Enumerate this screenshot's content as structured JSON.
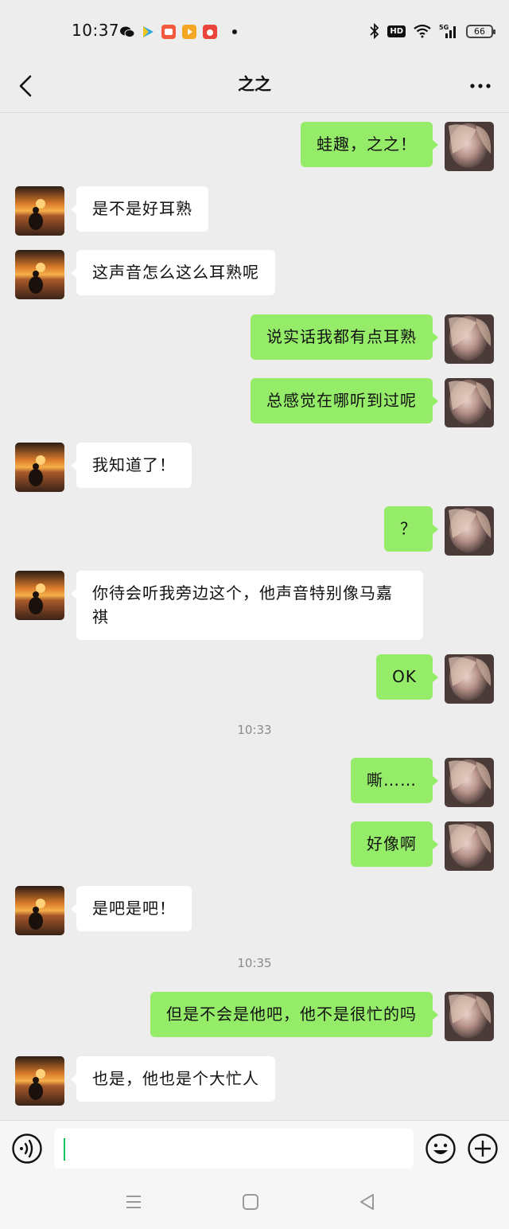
{
  "status_bar": {
    "time": "10:37",
    "network": "5G",
    "battery": "66"
  },
  "header": {
    "title": "之之"
  },
  "colors": {
    "outgoing_bubble": "#95ec69",
    "incoming_bubble": "#ffffff",
    "background": "#ededed",
    "caret": "#07c160"
  },
  "messages": [
    {
      "side": "out",
      "text": "蛙趣，之之！"
    },
    {
      "side": "in",
      "text": "是不是好耳熟"
    },
    {
      "side": "in",
      "text": "这声音怎么这么耳熟呢"
    },
    {
      "side": "out",
      "text": "说实话我都有点耳熟"
    },
    {
      "side": "out",
      "text": "总感觉在哪听到过呢"
    },
    {
      "side": "in",
      "text": "我知道了！"
    },
    {
      "side": "out",
      "text": "？"
    },
    {
      "side": "in",
      "text": "你待会听我旁边这个，他声音特别像马嘉祺"
    },
    {
      "side": "out",
      "text": "OK"
    },
    {
      "side": "time",
      "text": "10:33"
    },
    {
      "side": "out",
      "text": "嘶……"
    },
    {
      "side": "out",
      "text": "好像啊"
    },
    {
      "side": "in",
      "text": "是吧是吧！"
    },
    {
      "side": "time",
      "text": "10:35"
    },
    {
      "side": "out",
      "text": "但是不会是他吧，他不是很忙的吗"
    },
    {
      "side": "in",
      "text": "也是，他也是个大忙人"
    }
  ],
  "input": {
    "value": ""
  },
  "icons": {
    "back": "chevron-left-icon",
    "more": "more-dots-icon",
    "voice": "voice-icon",
    "emoji": "emoji-icon",
    "plus": "plus-icon",
    "sys_menu": "menu-lines-icon",
    "sys_home": "home-square-icon",
    "sys_back": "back-triangle-icon"
  }
}
